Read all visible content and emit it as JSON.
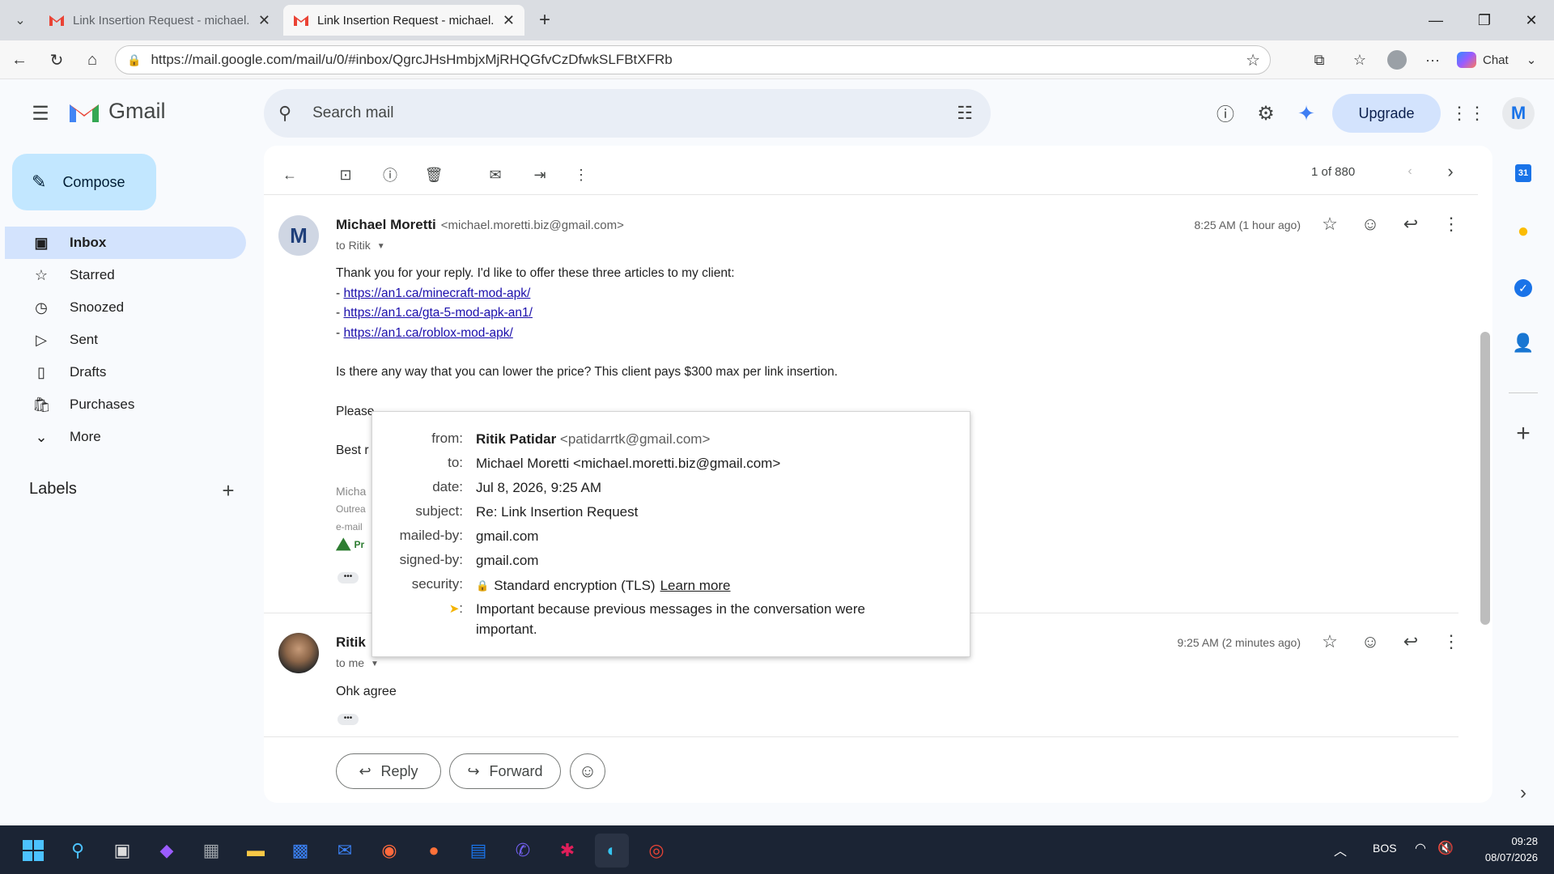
{
  "browser": {
    "tabs": [
      {
        "title": "Link Insertion Request - michael.m",
        "active": false
      },
      {
        "title": "Link Insertion Request - michael.m",
        "active": true
      }
    ],
    "url": "https://mail.google.com/mail/u/0/#inbox/QgrcJHsHmbjxMjRHQGfvCzDfwkSLFBtXFRb",
    "chat_label": "Chat"
  },
  "gmail": {
    "logo_text": "Gmail",
    "search_placeholder": "Search mail",
    "upgrade_label": "Upgrade",
    "avatar_letter": "M",
    "compose_label": "Compose",
    "nav": [
      {
        "label": "Inbox",
        "icon": "inbox-icon"
      },
      {
        "label": "Starred",
        "icon": "star-icon"
      },
      {
        "label": "Snoozed",
        "icon": "clock-icon"
      },
      {
        "label": "Sent",
        "icon": "send-icon"
      },
      {
        "label": "Drafts",
        "icon": "draft-icon"
      },
      {
        "label": "Purchases",
        "icon": "bag-icon"
      },
      {
        "label": "More",
        "icon": "chevron-down-icon"
      }
    ],
    "labels_heading": "Labels",
    "pagination": "1 of 880"
  },
  "message1": {
    "sender_name": "Michael Moretti",
    "sender_email": "<michael.moretti.biz@gmail.com>",
    "to": "to Ritik",
    "time": "8:25 AM (1 hour ago)",
    "avatar": "M",
    "line1": "Thank you for your reply. I'd like to offer these three articles to my client:",
    "links": [
      "https://an1.ca/minecraft-mod-apk/",
      "https://an1.ca/gta-5-mod-apk-an1/",
      "https://an1.ca/roblox-mod-apk/"
    ],
    "line2": "Is there any way that you can lower the price? This client pays $300 max per link insertion.",
    "line3": "Please",
    "line4": "Best r",
    "sig1": "Micha",
    "sig2": "Outrea",
    "sig3": "e-mail",
    "sig4": "Pr"
  },
  "message2": {
    "sender_name": "Ritik",
    "to": "to me",
    "time": "9:25 AM (2 minutes ago)",
    "body": "Ohk agree"
  },
  "actions": {
    "reply": "Reply",
    "forward": "Forward"
  },
  "popup": {
    "rows": [
      {
        "k": "from:",
        "v_bold": "Ritik Patidar",
        "v": " <patidarrtk@gmail.com>"
      },
      {
        "k": "to:",
        "v": "Michael Moretti <michael.moretti.biz@gmail.com>"
      },
      {
        "k": "date:",
        "v": "Jul 8, 2026, 9:25 AM"
      },
      {
        "k": "subject:",
        "v": "Re: Link Insertion Request"
      },
      {
        "k": "mailed-by:",
        "v": "gmail.com"
      },
      {
        "k": "signed-by:",
        "v": "gmail.com"
      }
    ],
    "security_key": "security:",
    "security_value": "Standard encryption (TLS)",
    "security_link": "Learn more",
    "importance_key": ":",
    "importance_value": "Important because previous messages in the conversation were important."
  },
  "taskbar": {
    "lang": "BOS",
    "time": "09:28",
    "date": "08/07/2026"
  }
}
